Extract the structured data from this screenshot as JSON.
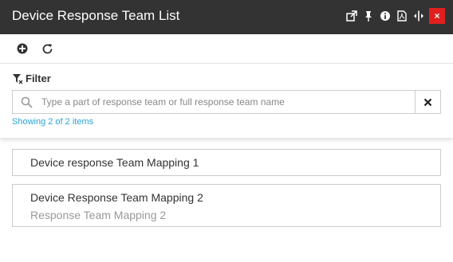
{
  "window": {
    "title": "Device Response Team List",
    "icons": [
      "popout-icon",
      "pin-icon",
      "info-icon",
      "pdf-icon",
      "resize-icon"
    ],
    "close_label": "×"
  },
  "toolbar": {
    "buttons": [
      "add-icon",
      "refresh-icon"
    ]
  },
  "filter": {
    "label": "Filter",
    "search_placeholder": "Type a part of response team or full response team name",
    "search_value": "",
    "clear_icon": "×",
    "count_text": "Showing 2 of 2 items"
  },
  "items": [
    {
      "title": "Device response Team Mapping 1",
      "subtitle": ""
    },
    {
      "title": "Device Response Team Mapping 2",
      "subtitle": "Response Team Mapping 2"
    }
  ],
  "colors": {
    "titlebar": "#333333",
    "close": "#e02020",
    "link": "#29a3d6"
  }
}
